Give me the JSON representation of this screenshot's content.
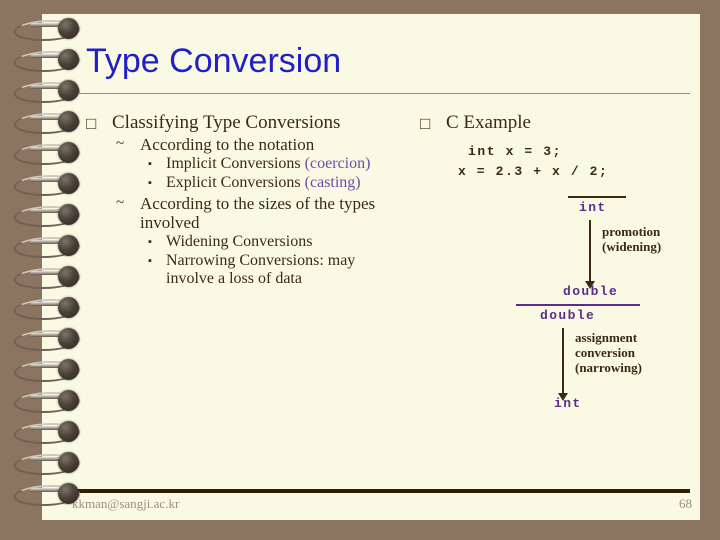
{
  "slide": {
    "title": "Type Conversion",
    "page_number": "68",
    "email": "kkman@sangji.ac.kr",
    "colors": {
      "background": "#8b7560",
      "page": "#fafae4",
      "title": "#2020c8",
      "body_text": "#3b2a13",
      "accent_purple": "#5b2d8e",
      "paren_purple": "#6a4fa8",
      "rule": "#9d8d72",
      "footer_rule": "#2e2006",
      "footer_text": "#9c8f7c"
    }
  },
  "bullets": {
    "square_hollow": "□",
    "tilde": "~",
    "square_small": "▪"
  },
  "left_column": {
    "heading": "Classifying Type Conversions",
    "groups": [
      {
        "label": "According to the notation",
        "items": [
          {
            "text": "Implicit Conversions",
            "paren": "(coercion)"
          },
          {
            "text": "Explicit Conversions",
            "paren": "(casting)"
          }
        ]
      },
      {
        "label": "According to the sizes of the types involved",
        "items": [
          {
            "text": "Widening Conversions",
            "paren": ""
          },
          {
            "text": "Narrowing Conversions: may involve a loss of data",
            "paren": ""
          }
        ]
      }
    ]
  },
  "right_column": {
    "heading": "C Example",
    "code": {
      "line1": "int x = 3;",
      "line2": "x = 2.3 + x / 2;"
    },
    "derivation": {
      "step1_type": "int",
      "step1_annotation_line1": "promotion",
      "step1_annotation_line2": "(widening)",
      "step2_type": "double",
      "step3_type": "double",
      "step3_annotation_line1": "assignment",
      "step3_annotation_line2": "conversion",
      "step3_annotation_line3": "(narrowing)",
      "step4_type": "int"
    }
  }
}
